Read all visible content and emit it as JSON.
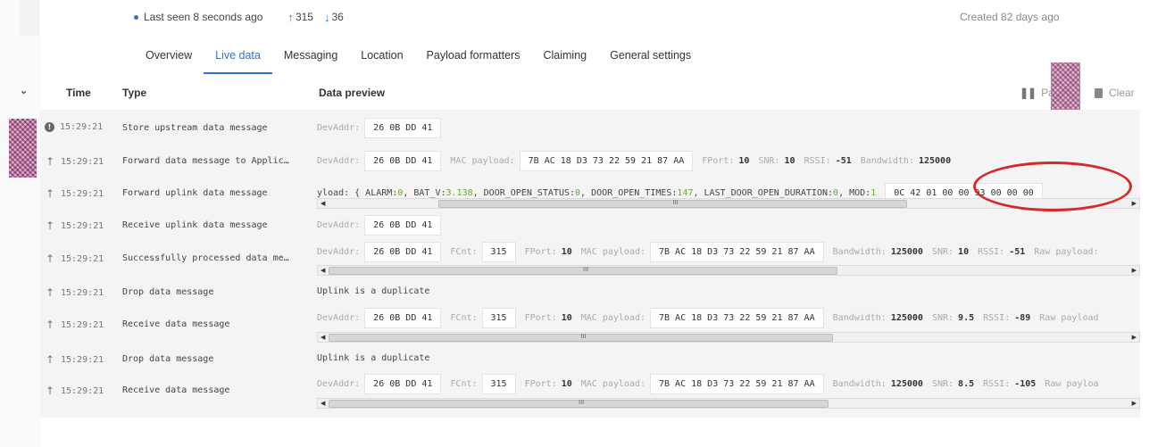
{
  "status": {
    "last_seen": "Last seen 8 seconds ago",
    "uplink_count": "315",
    "downlink_count": "36",
    "created": "Created 82 days ago"
  },
  "tabs": [
    {
      "label": "Overview",
      "active": false
    },
    {
      "label": "Live data",
      "active": true
    },
    {
      "label": "Messaging",
      "active": false
    },
    {
      "label": "Location",
      "active": false
    },
    {
      "label": "Payload formatters",
      "active": false
    },
    {
      "label": "Claiming",
      "active": false
    },
    {
      "label": "General settings",
      "active": false
    }
  ],
  "table": {
    "headers": {
      "time": "Time",
      "type": "Type",
      "preview": "Data preview"
    },
    "pause_label": "Pause",
    "clear_label": "Clear"
  },
  "rows": [
    {
      "icon": "info-icon",
      "time": "15:29:21",
      "type": "Store upstream data message",
      "devaddr_label": "DevAddr:",
      "devaddr": "26 0B DD 41"
    },
    {
      "icon": "arrow-up-icon",
      "time": "15:29:21",
      "type": "Forward data message to Applic…",
      "devaddr_label": "DevAddr:",
      "devaddr": "26 0B DD 41",
      "mac_label": "MAC payload:",
      "mac": "7B AC 18 D3 73 22 59 21 87 AA",
      "fport_label": "FPort:",
      "fport": "10",
      "snr_label": "SNR:",
      "snr": "10",
      "rssi_label": "RSSI:",
      "rssi": "-51",
      "bw_label": "Bandwidth:",
      "bw": "125000"
    },
    {
      "icon": "arrow-up-icon",
      "time": "15:29:21",
      "type": "Forward uplink data message",
      "payload_prefix": "yload: { ALARM: ",
      "alarm": "0",
      "bat_label": ", BAT_V: ",
      "bat": "3.138",
      "dos_label": ", DOOR_OPEN_STATUS: ",
      "dos": "0",
      "dot_label": ", DOOR_OPEN_TIMES: ",
      "dot": "147",
      "lod_label": ", LAST_DOOR_OPEN_DURATION: ",
      "lod": "0",
      "mod_label": ", MOD: ",
      "mod": "1",
      "raw_hex": "0C 42 01 00 00 93 00 00 00"
    },
    {
      "icon": "arrow-up-icon",
      "time": "15:29:21",
      "type": "Receive uplink data message",
      "devaddr_label": "DevAddr:",
      "devaddr": "26 0B DD 41"
    },
    {
      "icon": "arrow-up-icon",
      "time": "15:29:21",
      "type": "Successfully processed data me…",
      "devaddr_label": "DevAddr:",
      "devaddr": "26 0B DD 41",
      "fcnt_label": "FCnt:",
      "fcnt": "315",
      "fport_label": "FPort:",
      "fport": "10",
      "mac_label": "MAC payload:",
      "mac": "7B AC 18 D3 73 22 59 21 87 AA",
      "bw_label": "Bandwidth:",
      "bw": "125000",
      "snr_label": "SNR:",
      "snr": "10",
      "rssi_label": "RSSI:",
      "rssi": "-51",
      "raw_label": "Raw payload:"
    },
    {
      "icon": "arrow-up-icon",
      "time": "15:29:21",
      "type": "Drop data message",
      "message": "Uplink is a duplicate"
    },
    {
      "icon": "arrow-up-icon",
      "time": "15:29:21",
      "type": "Receive data message",
      "devaddr_label": "DevAddr:",
      "devaddr": "26 0B DD 41",
      "fcnt_label": "FCnt:",
      "fcnt": "315",
      "fport_label": "FPort:",
      "fport": "10",
      "mac_label": "MAC payload:",
      "mac": "7B AC 18 D3 73 22 59 21 87 AA",
      "bw_label": "Bandwidth:",
      "bw": "125000",
      "snr_label": "SNR:",
      "snr": "9.5",
      "rssi_label": "RSSI:",
      "rssi": "-89",
      "raw_label": "Raw payload"
    },
    {
      "icon": "arrow-up-icon",
      "time": "15:29:21",
      "type": "Drop data message",
      "message": "Uplink is a duplicate"
    },
    {
      "icon": "arrow-up-icon",
      "time": "15:29:21",
      "type": "Receive data message",
      "devaddr_label": "DevAddr:",
      "devaddr": "26 0B DD 41",
      "fcnt_label": "FCnt:",
      "fcnt": "315",
      "fport_label": "FPort:",
      "fport": "10",
      "mac_label": "MAC payload:",
      "mac": "7B AC 18 D3 73 22 59 21 87 AA",
      "bw_label": "Bandwidth:",
      "bw": "125000",
      "snr_label": "SNR:",
      "snr": "8.5",
      "rssi_label": "RSSI:",
      "rssi": "-105",
      "raw_label": "Raw payloa"
    }
  ],
  "colors": {
    "accent": "#2f73c9",
    "highlight_ellipse": "#d42a2a",
    "json_number": "#6aa636"
  }
}
